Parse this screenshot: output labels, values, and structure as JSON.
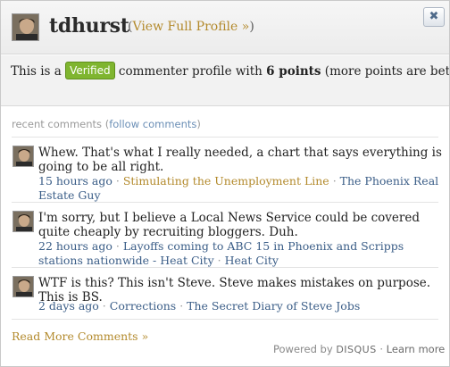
{
  "header": {
    "username": "tdhurst",
    "view_profile_open": "(",
    "view_profile_label": "View Full Profile »",
    "view_profile_close": ")",
    "close_label": "✖"
  },
  "profile": {
    "prefix": "This is a",
    "badge": "Verified",
    "middle": "commenter profile with",
    "points": "6 points",
    "suffix": "(more points are better)."
  },
  "recent": {
    "label": "recent comments",
    "follow_open": "(",
    "follow_label": "follow comments",
    "follow_close": ")"
  },
  "comments": [
    {
      "text": "Whew. That's what I really needed, a chart that says everything is going to be all right.",
      "time": "15 hours ago",
      "post": "Stimulating the Unemployment Line",
      "site": "The Phoenix Real Estate Guy"
    },
    {
      "text": "I'm sorry, but I believe a Local News Service could be covered quite cheaply by recruiting bloggers. Duh.",
      "time": "22 hours ago",
      "post": "Layoffs coming to ABC 15 in Phoenix and Scripps stations nationwide - Heat City",
      "site": "Heat City"
    },
    {
      "text": "WTF is this? This isn't Steve. Steve makes mistakes on purpose. This is BS.",
      "time": "2 days ago",
      "post": "Corrections",
      "site": "The Secret Diary of Steve Jobs"
    }
  ],
  "footer": {
    "read_more": "Read More Comments »",
    "powered_by": "Powered by",
    "brand": "DISQUS",
    "learn_more": "Learn more"
  },
  "icons": {
    "avatar": "user-avatar-photo",
    "close": "close-icon"
  },
  "colors": {
    "link_gold": "#b38a2c",
    "link_blue": "#3a5d87",
    "verified_green": "#7fb52f"
  }
}
